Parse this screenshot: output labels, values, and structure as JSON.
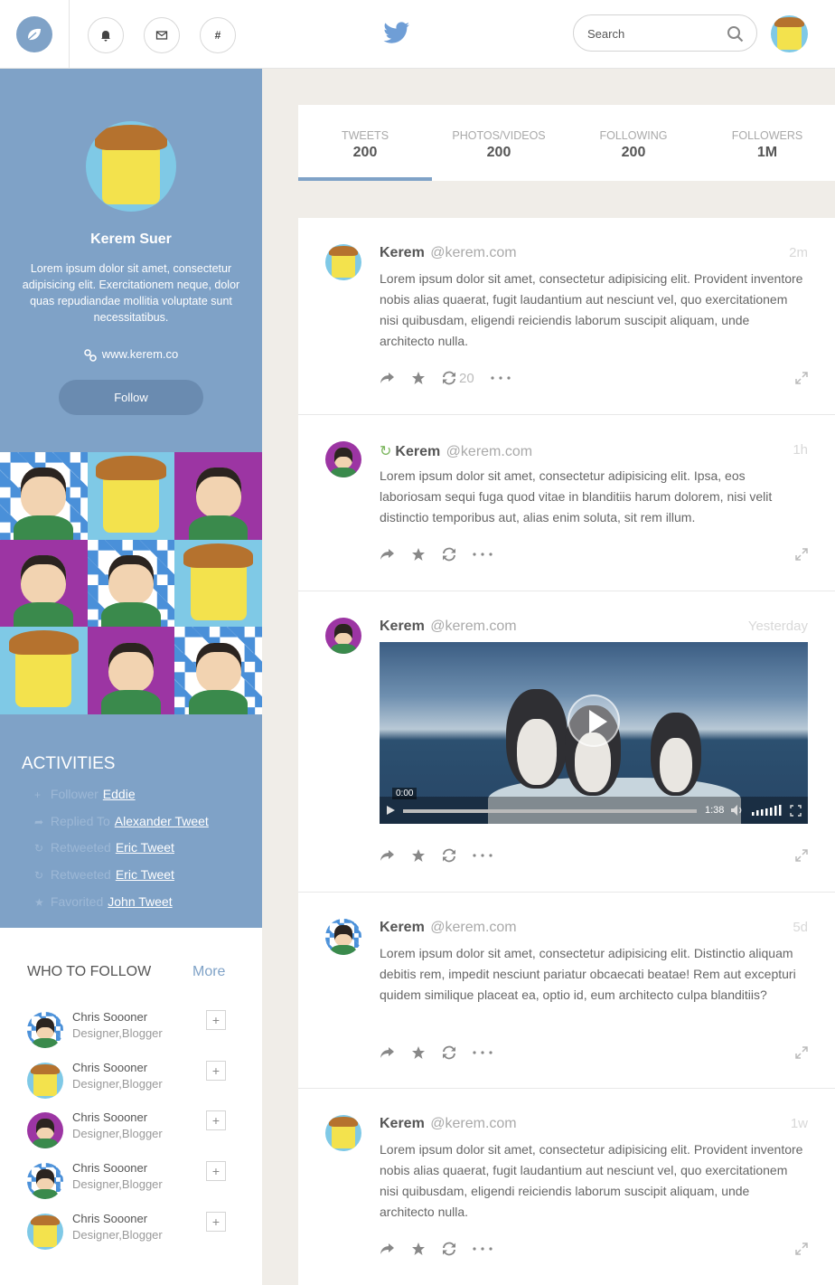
{
  "search": {
    "placeholder": "Search"
  },
  "nav": {
    "hashtag_label": "#"
  },
  "profile": {
    "name": "Kerem Suer",
    "bio": "Lorem ipsum dolor sit amet, consectetur adipisicing elit. Exercitationem neque, dolor quas repudiandae mollitia voluptate sunt necessitatibus.",
    "website": "www.kerem.co",
    "follow_label": "Follow"
  },
  "activities": {
    "title": "ACTIVITIES",
    "items": [
      {
        "verb": "Follower",
        "target": "Eddie",
        "icon": "plus-icon"
      },
      {
        "verb": "Replied To",
        "target": "Alexander Tweet",
        "icon": "reply-icon"
      },
      {
        "verb": "Retweeted",
        "target": "Eric Tweet",
        "icon": "retweet-icon"
      },
      {
        "verb": "Retweeted",
        "target": "Eric Tweet",
        "icon": "retweet-icon"
      },
      {
        "verb": "Favorited",
        "target": "John Tweet",
        "icon": "star-icon"
      }
    ]
  },
  "who_to_follow": {
    "title": "WHO TO FOLLOW",
    "more_label": "More",
    "add_label": "+",
    "people": [
      {
        "name": "Chris Soooner",
        "role": "Designer,Blogger"
      },
      {
        "name": "Chris Soooner",
        "role": "Designer,Blogger"
      },
      {
        "name": "Chris Soooner",
        "role": "Designer,Blogger"
      },
      {
        "name": "Chris Soooner",
        "role": "Designer,Blogger"
      },
      {
        "name": "Chris Soooner",
        "role": "Designer,Blogger"
      }
    ]
  },
  "stats": [
    {
      "label": "TWEETS",
      "value": "200"
    },
    {
      "label": "PHOTOS/VIDEOS",
      "value": "200"
    },
    {
      "label": "FOLLOWING",
      "value": "200"
    },
    {
      "label": "FOLLOWERS",
      "value": "1M"
    }
  ],
  "tweets": [
    {
      "name": "Kerem",
      "handle": "@kerem.com",
      "time": "2m",
      "text": "Lorem ipsum dolor sit amet, consectetur adipisicing elit. Provident inventore nobis alias quaerat, fugit laudantium aut nesciunt vel, quo exercitationem nisi quibusdam, eligendi reiciendis laborum suscipit aliquam, unde architecto nulla.",
      "retweet_count": "20"
    },
    {
      "name": "Kerem",
      "handle": "@kerem.com",
      "time": "1h",
      "text": "Lorem ipsum dolor sit amet, consectetur adipisicing elit. Ipsa, eos laboriosam sequi fuga quod vitae in blanditiis harum dolorem, nisi velit distinctio temporibus aut, alias enim soluta, sit rem illum."
    },
    {
      "name": "Kerem",
      "handle": "@kerem.com",
      "time": "Yesterday",
      "video": {
        "current": "0:00",
        "duration": "1:38"
      }
    },
    {
      "name": "Kerem",
      "handle": "@kerem.com",
      "time": "5d",
      "text": "Lorem ipsum dolor sit amet, consectetur adipisicing elit. Distinctio aliquam debitis rem, impedit nesciunt pariatur obcaecati beatae! Rem aut excepturi quidem similique placeat ea, optio id, eum architecto culpa blanditiis?"
    },
    {
      "name": "Kerem",
      "handle": "@kerem.com",
      "time": "1w",
      "text": "Lorem ipsum dolor sit amet, consectetur adipisicing elit. Provident inventore nobis alias quaerat, fugit laudantium aut nesciunt vel, quo exercitationem nisi quibusdam, eligendi reiciendis laborum suscipit aliquam, unde architecto nulla."
    }
  ],
  "colors": {
    "accent": "#7fa2c7",
    "retweet": "#7ab55c"
  }
}
